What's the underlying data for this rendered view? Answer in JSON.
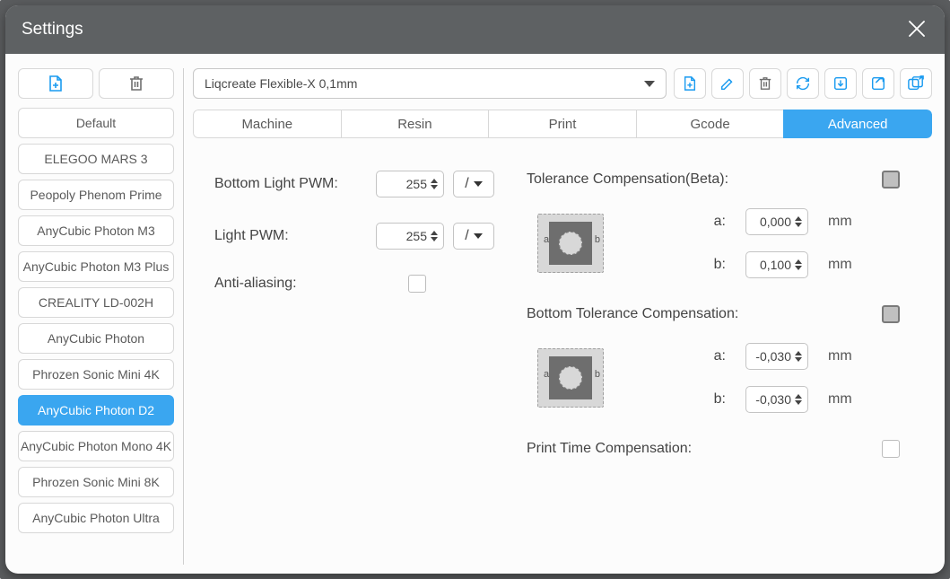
{
  "window": {
    "title": "Settings"
  },
  "printers": [
    {
      "name": "Default"
    },
    {
      "name": "ELEGOO MARS 3"
    },
    {
      "name": "Peopoly Phenom Prime"
    },
    {
      "name": "AnyCubic Photon M3"
    },
    {
      "name": "AnyCubic Photon M3 Plus"
    },
    {
      "name": "CREALITY LD-002H"
    },
    {
      "name": "AnyCubic Photon"
    },
    {
      "name": "Phrozen Sonic Mini 4K"
    },
    {
      "name": "AnyCubic Photon D2"
    },
    {
      "name": "AnyCubic Photon Mono 4K"
    },
    {
      "name": "Phrozen Sonic Mini 8K"
    },
    {
      "name": "AnyCubic Photon Ultra"
    }
  ],
  "selected_printer_index": 8,
  "profile": {
    "selected": "Liqcreate Flexible-X 0,1mm"
  },
  "tabs": {
    "machine": "Machine",
    "resin": "Resin",
    "print": "Print",
    "gcode": "Gcode",
    "advanced": "Advanced"
  },
  "active_tab": "advanced",
  "advanced": {
    "bottom_light_pwm_label": "Bottom Light PWM:",
    "bottom_light_pwm_value": "255",
    "light_pwm_label": "Light PWM:",
    "light_pwm_value": "255",
    "slash_sel": "/",
    "anti_aliasing_label": "Anti-aliasing:",
    "anti_aliasing_checked": false,
    "tolerance_comp_label": "Tolerance Compensation(Beta):",
    "tolerance_comp_checked": true,
    "tol_a_label": "a:",
    "tol_a_value": "0,000",
    "tol_b_label": "b:",
    "tol_b_value": "0,100",
    "bottom_tol_comp_label": "Bottom Tolerance Compensation:",
    "bottom_tol_comp_checked": true,
    "btol_a_value": "-0,030",
    "btol_b_value": "-0,030",
    "print_time_comp_label": "Print Time Compensation:",
    "print_time_comp_checked": false,
    "unit_mm": "mm"
  }
}
